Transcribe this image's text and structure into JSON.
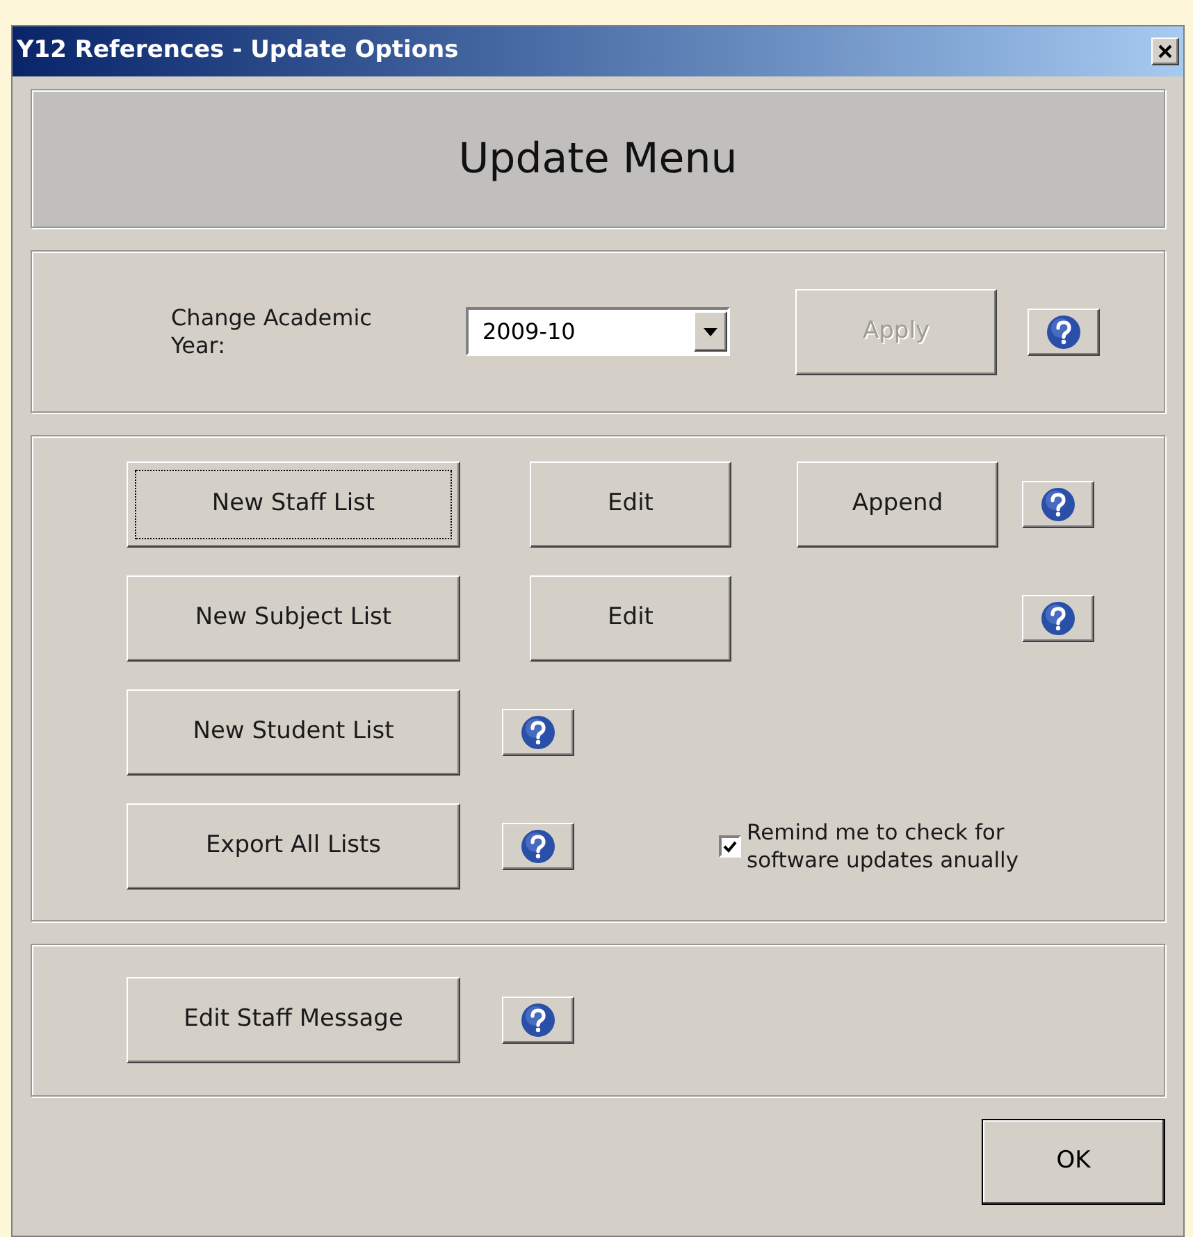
{
  "window": {
    "title": "Y12 References - Update Options"
  },
  "header": "Update Menu",
  "academic_year": {
    "label": "Change Academic Year:",
    "value": "2009-10",
    "apply": {
      "label": "Apply",
      "disabled": true
    }
  },
  "list_rows": [
    {
      "kind": "editable",
      "main": {
        "label": "New Staff List",
        "focused": true
      },
      "edit": "Edit",
      "append": "Append"
    },
    {
      "kind": "editable",
      "main": {
        "label": "New Subject List",
        "focused": false
      },
      "edit": "Edit"
    },
    {
      "kind": "plain",
      "main": {
        "label": "New Student List",
        "focused": false
      }
    },
    {
      "kind": "plain",
      "main": {
        "label": "Export All Lists",
        "focused": false
      }
    }
  ],
  "reminder": {
    "label": "Remind me to check for software updates anually",
    "checked": true
  },
  "staff_message": {
    "label": "Edit Staff Message"
  },
  "ok": {
    "label": "OK"
  }
}
